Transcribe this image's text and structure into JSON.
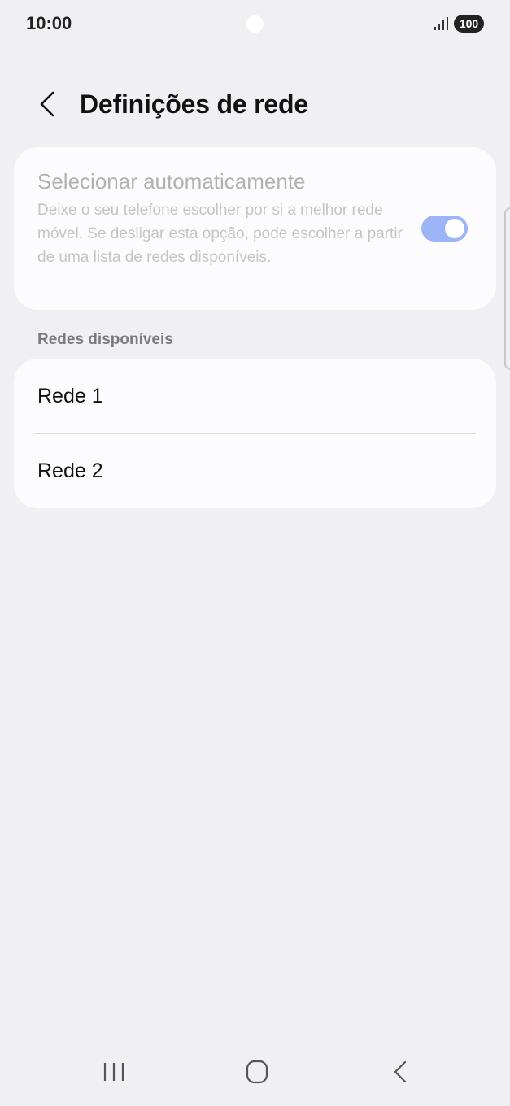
{
  "status_bar": {
    "time": "10:00",
    "battery": "100",
    "icons": [
      "camera-dot",
      "signal-icon",
      "battery-icon"
    ]
  },
  "header": {
    "title": "Definições de rede",
    "back_icon": "chevron-left-icon"
  },
  "auto_select": {
    "title": "Selecionar automaticamente",
    "description": "Deixe o seu telefone escolher por si a melhor rede móvel. Se desligar esta opção, pode escolher a partir de uma lista de redes disponíveis.",
    "enabled": true,
    "toggle_color": "#9db4f6"
  },
  "networks": {
    "section_label": "Redes disponíveis",
    "items": [
      {
        "label": "Rede 1"
      },
      {
        "label": "Rede 2"
      }
    ]
  },
  "nav_bar": {
    "icons": [
      "recents-icon",
      "home-icon",
      "back-icon"
    ]
  }
}
